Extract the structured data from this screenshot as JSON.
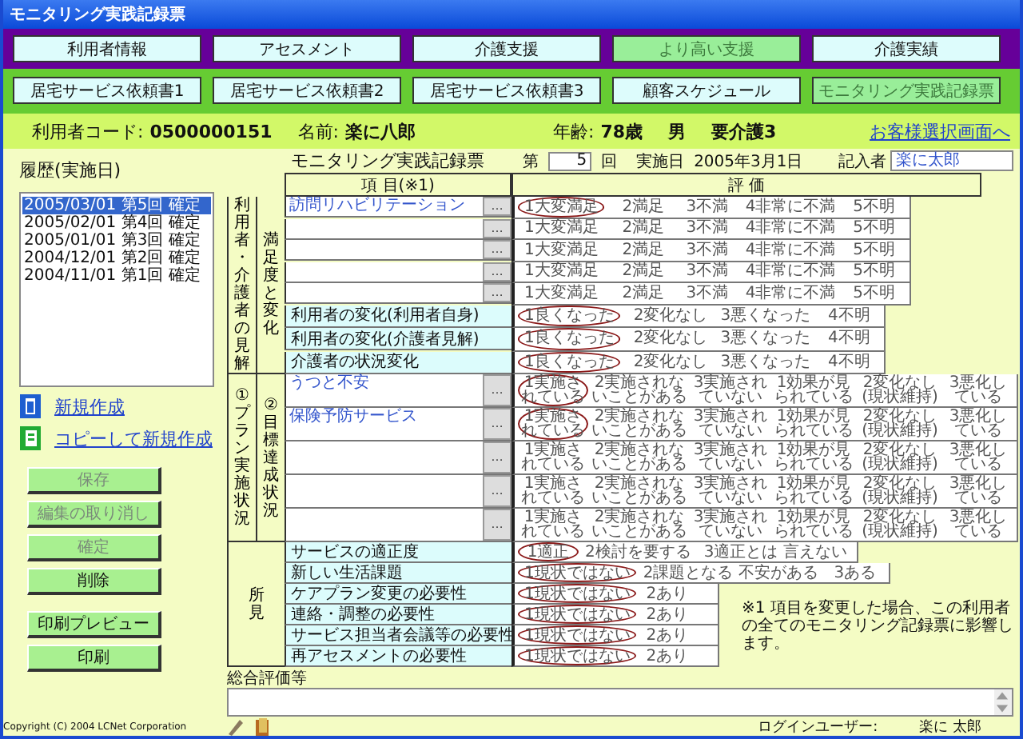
{
  "window": {
    "title": "モニタリング実践記録票"
  },
  "nav_rows": [
    [
      {
        "label": "利用者情報",
        "selected": false
      },
      {
        "label": "アセスメント",
        "selected": false
      },
      {
        "label": "介護支援",
        "selected": false
      },
      {
        "label": "より高い支援",
        "selected": true
      },
      {
        "label": "介護実績",
        "selected": false
      }
    ],
    [
      {
        "label": "居宅サービス依頼書1",
        "selected": false
      },
      {
        "label": "居宅サービス依頼書2",
        "selected": false
      },
      {
        "label": "居宅サービス依頼書3",
        "selected": false
      },
      {
        "label": "顧客スケジュール",
        "selected": false
      },
      {
        "label": "モニタリング実践記録票",
        "selected": true
      }
    ]
  ],
  "client": {
    "code_label": "利用者コード:",
    "code": "0500000151",
    "name_label": "名前:",
    "name": "楽に八郎",
    "age_label": "年齢:",
    "age": "78歳",
    "sex": "男",
    "care_level": "要介護3",
    "link": "お客様選択画面へ"
  },
  "history": {
    "label": "履歴(実施日)",
    "items": [
      {
        "text": "2005/03/01 第5回 確定",
        "selected": true
      },
      {
        "text": "2005/02/01 第4回 確定",
        "selected": false
      },
      {
        "text": "2005/01/01 第3回 確定",
        "selected": false
      },
      {
        "text": "2004/12/01 第2回 確定",
        "selected": false
      },
      {
        "text": "2004/11/01 第1回 確定",
        "selected": false
      }
    ]
  },
  "actions": [
    {
      "label": "新規作成",
      "kind": "new"
    },
    {
      "label": "コピーして新規作成",
      "kind": "copy"
    }
  ],
  "button_groups": [
    [
      {
        "label": "保存",
        "disabled": true
      },
      {
        "label": "編集の取り消し",
        "disabled": true
      },
      {
        "label": "確定",
        "disabled": true
      },
      {
        "label": "削除",
        "disabled": false
      }
    ],
    [
      {
        "label": "印刷プレビュー",
        "disabled": false
      },
      {
        "label": "印刷",
        "disabled": false
      }
    ]
  ],
  "copyright": "Copyright (C) 2004 LCNet Corporation",
  "form": {
    "title": "モニタリング実践記録票",
    "count_prefix": "第",
    "count": "5",
    "count_suffix": "回",
    "date_label": "実施日",
    "date": "2005年3月1日",
    "author_label": "記入者",
    "author": "楽に太郎",
    "headers": [
      "項 目(※1)",
      "評 価"
    ],
    "sections": [
      {
        "kind": "opinion",
        "label": "利用者・介護者の見解",
        "sublabel": "満足度と変化",
        "rows": [
          {
            "kind": "pick",
            "item": "訪問リハビリテーション",
            "picker": "…",
            "options": [
              {
                "label": "1大変満足",
                "selected": true
              },
              {
                "label": "2満足",
                "selected": false
              },
              {
                "label": "3不満",
                "selected": false
              },
              {
                "label": "4非常に不満",
                "selected": false
              },
              {
                "label": "5不明",
                "selected": false
              }
            ]
          },
          {
            "kind": "pick",
            "picker": "…",
            "options": [
              {
                "label": "1大変満足",
                "selected": false
              },
              {
                "label": "2満足",
                "selected": false
              },
              {
                "label": "3不満",
                "selected": false
              },
              {
                "label": "4非常に不満",
                "selected": false
              },
              {
                "label": "5不明",
                "selected": false
              }
            ]
          },
          {
            "kind": "pick",
            "picker": "…",
            "options": [
              {
                "label": "1大変満足",
                "selected": false
              },
              {
                "label": "2満足",
                "selected": false
              },
              {
                "label": "3不満",
                "selected": false
              },
              {
                "label": "4非常に不満",
                "selected": false
              },
              {
                "label": "5不明",
                "selected": false
              }
            ]
          },
          {
            "kind": "pick",
            "picker": "…",
            "options": [
              {
                "label": "1大変満足",
                "selected": false
              },
              {
                "label": "2満足",
                "selected": false
              },
              {
                "label": "3不満",
                "selected": false
              },
              {
                "label": "4非常に不満",
                "selected": false
              },
              {
                "label": "5不明",
                "selected": false
              }
            ]
          },
          {
            "kind": "pick",
            "picker": "…",
            "options": [
              {
                "label": "1大変満足",
                "selected": false
              },
              {
                "label": "2満足",
                "selected": false
              },
              {
                "label": "3不満",
                "selected": false
              },
              {
                "label": "4非常に不満",
                "selected": false
              },
              {
                "label": "5不明",
                "selected": false
              }
            ]
          },
          {
            "kind": "fixed",
            "item": "利用者の変化(利用者自身)",
            "options": [
              {
                "label": "1良くなった",
                "selected": true
              },
              {
                "label": "2変化なし",
                "selected": false
              },
              {
                "label": "3悪くなった",
                "selected": false
              },
              {
                "label": "4不明",
                "selected": false
              }
            ]
          },
          {
            "kind": "fixed",
            "item": "利用者の変化(介護者見解)",
            "options": [
              {
                "label": "1良くなった",
                "selected": true
              },
              {
                "label": "2変化なし",
                "selected": false
              },
              {
                "label": "3悪くなった",
                "selected": false
              },
              {
                "label": "4不明",
                "selected": false
              }
            ]
          },
          {
            "kind": "fixed",
            "item": "介護者の状況変化",
            "options": [
              {
                "label": "1良くなった",
                "selected": true
              },
              {
                "label": "2変化なし",
                "selected": false
              },
              {
                "label": "3悪くなった",
                "selected": false
              },
              {
                "label": "4不明",
                "selected": false
              }
            ]
          }
        ]
      },
      {
        "kind": "plan",
        "label": "①プラン実施状況",
        "sublabel": "②目標達成状況",
        "rows": [
          {
            "kind": "pick",
            "item": "うつと不安",
            "picker": "…",
            "options": [
              {
                "label": "1実施されている",
                "selected": true
              },
              {
                "label": "2実施されないことがある",
                "selected": false
              },
              {
                "label": "3実施されていない",
                "selected": false
              },
              {
                "label": "1効果が見られている",
                "selected": false
              },
              {
                "label": "2変化なし(現状維持)",
                "selected": false
              },
              {
                "label": "3悪化している",
                "selected": false
              }
            ]
          },
          {
            "kind": "pick",
            "item": "保険予防サービス",
            "picker": "…",
            "options": [
              {
                "label": "1実施されている",
                "selected": true
              },
              {
                "label": "2実施されないことがある",
                "selected": false
              },
              {
                "label": "3実施されていない",
                "selected": false
              },
              {
                "label": "1効果が見られている",
                "selected": false
              },
              {
                "label": "2変化なし(現状維持)",
                "selected": false
              },
              {
                "label": "3悪化している",
                "selected": false
              }
            ]
          },
          {
            "kind": "pick",
            "picker": "…",
            "options": [
              {
                "label": "1実施されている",
                "selected": false
              },
              {
                "label": "2実施されないことがある",
                "selected": false
              },
              {
                "label": "3実施されていない",
                "selected": false
              },
              {
                "label": "1効果が見られている",
                "selected": false
              },
              {
                "label": "2変化なし(現状維持)",
                "selected": false
              },
              {
                "label": "3悪化している",
                "selected": false
              }
            ]
          },
          {
            "kind": "pick",
            "picker": "…",
            "options": [
              {
                "label": "1実施されている",
                "selected": false
              },
              {
                "label": "2実施されないことがある",
                "selected": false
              },
              {
                "label": "3実施されていない",
                "selected": false
              },
              {
                "label": "1効果が見られている",
                "selected": false
              },
              {
                "label": "2変化なし(現状維持)",
                "selected": false
              },
              {
                "label": "3悪化している",
                "selected": false
              }
            ]
          },
          {
            "kind": "pick",
            "picker": "…",
            "options": [
              {
                "label": "1実施されている",
                "selected": false
              },
              {
                "label": "2実施されないことがある",
                "selected": false
              },
              {
                "label": "3実施されていない",
                "selected": false
              },
              {
                "label": "1効果が見られている",
                "selected": false
              },
              {
                "label": "2変化なし(現状維持)",
                "selected": false
              },
              {
                "label": "3悪化している",
                "selected": false
              }
            ]
          }
        ]
      },
      {
        "kind": "findings",
        "label": "所見",
        "note": "※1 項目を変更した場合、この利用者の全てのモニタリング記録票に影響します。",
        "rows": [
          {
            "kind": "fixed",
            "item": "サービスの適正度",
            "options": [
              {
                "label": "1適正",
                "selected": true
              },
              {
                "label": "2検討を要する",
                "selected": false
              },
              {
                "label": "3適正とは 言えない",
                "selected": false
              }
            ]
          },
          {
            "kind": "fixed",
            "item": "新しい生活課題",
            "options": [
              {
                "label": "1現状ではない",
                "selected": true
              },
              {
                "label": "2課題となる 不安がある",
                "selected": false
              },
              {
                "label": "3ある",
                "selected": false
              }
            ]
          },
          {
            "kind": "fixed",
            "item": "ケアプラン変更の必要性",
            "options": [
              {
                "label": "1現状ではない",
                "selected": true
              },
              {
                "label": "2あり",
                "selected": false
              }
            ]
          },
          {
            "kind": "fixed",
            "item": "連絡・調整の必要性",
            "options": [
              {
                "label": "1現状ではない",
                "selected": true
              },
              {
                "label": "2あり",
                "selected": false
              }
            ]
          },
          {
            "kind": "fixed",
            "item": "サービス担当者会議等の必要性",
            "options": [
              {
                "label": "1現状ではない",
                "selected": true
              },
              {
                "label": "2あり",
                "selected": false
              }
            ]
          },
          {
            "kind": "fixed",
            "item": "再アセスメントの必要性",
            "options": [
              {
                "label": "1現状ではない",
                "selected": true
              },
              {
                "label": "2あり",
                "selected": false
              }
            ]
          }
        ]
      }
    ],
    "comment_label": "総合評価等"
  },
  "login": {
    "label": "ログインユーザー:",
    "user": "楽に 太郎"
  }
}
